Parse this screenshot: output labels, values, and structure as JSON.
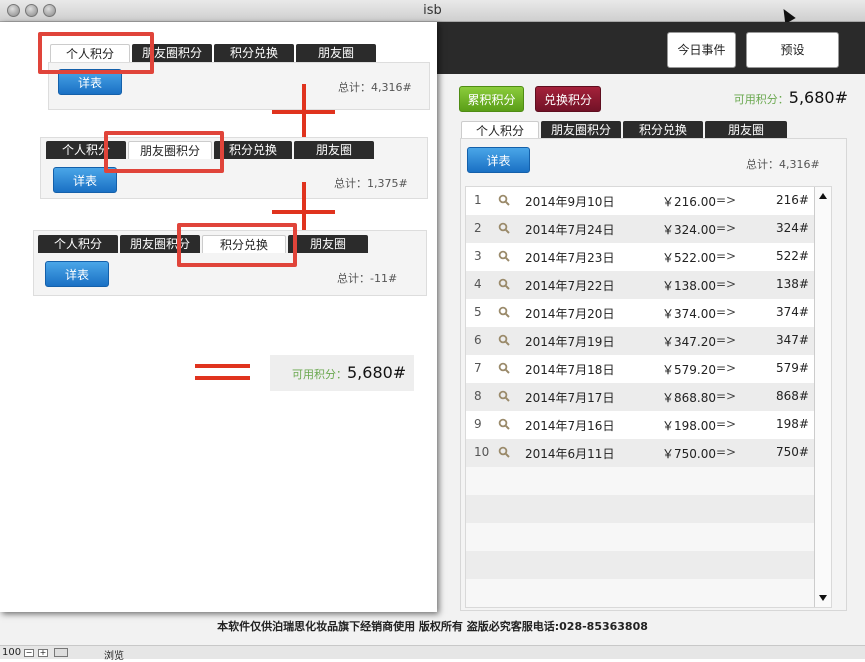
{
  "window": {
    "title": "isb"
  },
  "header": {
    "today_events": "今日事件",
    "preset": "预设"
  },
  "tabs": {
    "personal": "个人积分",
    "friends_circle_points": "朋友圈积分",
    "exchange": "积分兑换",
    "friends_circle": "朋友圈"
  },
  "overlay": {
    "detail_btn": "详表",
    "total1": "总计：4,316#",
    "total2": "总计：1,375#",
    "total3": "总计：-11#",
    "available_label": "可用积分：",
    "available_value": "5,680#"
  },
  "right": {
    "accumulated_btn": "累积积分",
    "exchange_btn": "兑换积分",
    "available_label": "可用积分：",
    "available_value": "5,680#",
    "detail_btn": "详表",
    "total": "总计：4,316#",
    "rows": [
      {
        "idx": "1",
        "date": "2014年9月10日",
        "amount": "￥216.00",
        "arrow": "=>",
        "points": "216#"
      },
      {
        "idx": "2",
        "date": "2014年7月24日",
        "amount": "￥324.00",
        "arrow": "=>",
        "points": "324#"
      },
      {
        "idx": "3",
        "date": "2014年7月23日",
        "amount": "￥522.00",
        "arrow": "=>",
        "points": "522#"
      },
      {
        "idx": "4",
        "date": "2014年7月22日",
        "amount": "￥138.00",
        "arrow": "=>",
        "points": "138#"
      },
      {
        "idx": "5",
        "date": "2014年7月20日",
        "amount": "￥374.00",
        "arrow": "=>",
        "points": "374#"
      },
      {
        "idx": "6",
        "date": "2014年7月19日",
        "amount": "￥347.20",
        "arrow": "=>",
        "points": "347#"
      },
      {
        "idx": "7",
        "date": "2014年7月18日",
        "amount": "￥579.20",
        "arrow": "=>",
        "points": "579#"
      },
      {
        "idx": "8",
        "date": "2014年7月17日",
        "amount": "￥868.80",
        "arrow": "=>",
        "points": "868#"
      },
      {
        "idx": "9",
        "date": "2014年7月16日",
        "amount": "￥198.00",
        "arrow": "=>",
        "points": "198#"
      },
      {
        "idx": "10",
        "date": "2014年6月11日",
        "amount": "￥750.00",
        "arrow": "=>",
        "points": "750#"
      }
    ]
  },
  "footer": {
    "notice": "本软件仅供泊瑞思化妆品旗下经销商使用 版权所有 盗版必究客服电话:028-85363808"
  },
  "statusbar": {
    "zoom": "100",
    "browse": "浏览"
  },
  "colors": {
    "accent_red": "#e0443a",
    "green": "#6aa84f",
    "maroon": "#721227",
    "blue": "#1a70c4"
  }
}
